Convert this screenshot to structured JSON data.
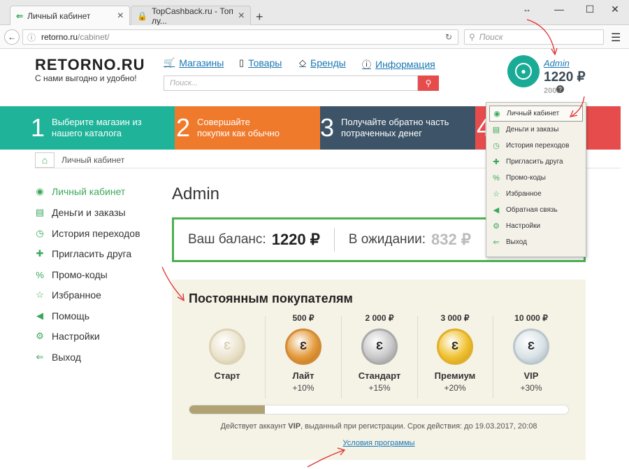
{
  "browser": {
    "tabs": [
      {
        "title": "Личный кабинет"
      },
      {
        "title": "TopCashback.ru - Топ лу..."
      }
    ],
    "url_domain": "retorno.ru",
    "url_path": "/cabinet/",
    "search_placeholder": "Поиск"
  },
  "header": {
    "logo": "RETORNO.RU",
    "slogan": "С нами выгодно и удобно!",
    "nav": [
      "Магазины",
      "Товары",
      "Бренды",
      "Информация"
    ],
    "search_placeholder": "Поиск..."
  },
  "user": {
    "name": "Admin",
    "balance": "1220 ₽",
    "pending": "200₽"
  },
  "banner": [
    {
      "num": "1",
      "text": "Выберите магазин из нашего каталога",
      "color": "#1fb39a"
    },
    {
      "num": "2",
      "text": "Совершайте покупки как обычно",
      "color": "#f07a2c"
    },
    {
      "num": "3",
      "text": "Получайте обратно часть потраченных денег",
      "color": "#3d5468"
    },
    {
      "num": "4",
      "text": "",
      "color": "#e74c4c"
    }
  ],
  "breadcrumb": "Личный кабинет",
  "sidebar": [
    {
      "label": "Личный кабинет",
      "icon": "user-circle-icon"
    },
    {
      "label": "Деньги и заказы",
      "icon": "money-icon"
    },
    {
      "label": "История переходов",
      "icon": "clock-icon"
    },
    {
      "label": "Пригласить друга",
      "icon": "add-user-icon"
    },
    {
      "label": "Промо-коды",
      "icon": "percent-icon"
    },
    {
      "label": "Избранное",
      "icon": "star-icon"
    },
    {
      "label": "Помощь",
      "icon": "megaphone-icon"
    },
    {
      "label": "Настройки",
      "icon": "gear-icon"
    },
    {
      "label": "Выход",
      "icon": "exit-icon"
    }
  ],
  "main": {
    "title": "Admin",
    "balance_label": "Ваш баланс:",
    "balance_value": "1220 ₽",
    "pending_label": "В ожидании:",
    "pending_value": "832 ₽"
  },
  "loyalty": {
    "title": "Постоянным покупателям",
    "levels": [
      {
        "price": "",
        "name": "Старт",
        "bonus": "",
        "color": "#e9e1c8"
      },
      {
        "price": "500 ₽",
        "name": "Лайт",
        "bonus": "+10%",
        "color": "#e39a3b"
      },
      {
        "price": "2 000 ₽",
        "name": "Стандарт",
        "bonus": "+15%",
        "color": "#c9c9c9"
      },
      {
        "price": "3 000 ₽",
        "name": "Премиум",
        "bonus": "+20%",
        "color": "#f0c232"
      },
      {
        "price": "10 000 ₽",
        "name": "VIP",
        "bonus": "+30%",
        "color": "#d9e2e6"
      }
    ],
    "progress": 0.2,
    "note_prefix": "Действует аккаунт ",
    "note_account": "VIP",
    "note_suffix": ", выданный при регистрации. Срок действия: до 19.03.2017, 20:08",
    "terms_link": "Условия программы"
  },
  "dropdown": [
    {
      "label": "Личный кабинет"
    },
    {
      "label": "Деньги и заказы"
    },
    {
      "label": "История переходов"
    },
    {
      "label": "Пригласить друга"
    },
    {
      "label": "Промо-коды"
    },
    {
      "label": "Избранное"
    },
    {
      "label": "Обратная связь"
    },
    {
      "label": "Настройки"
    },
    {
      "label": "Выход"
    }
  ],
  "colors": {
    "accent_green": "#3aa85a",
    "link_blue": "#1a78b4",
    "annotation_red": "#e03030"
  }
}
